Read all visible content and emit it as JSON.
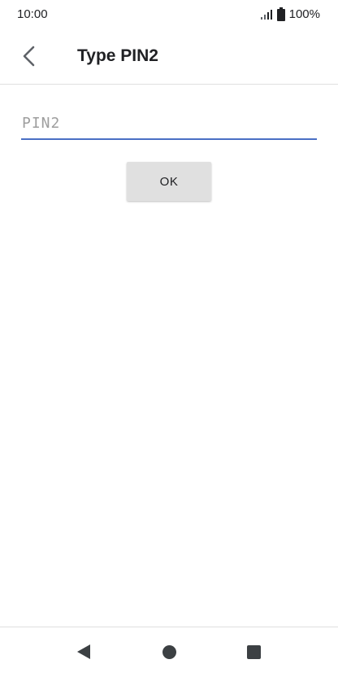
{
  "status_bar": {
    "time": "10:00",
    "battery": "100%",
    "icons": [
      "signal-icon",
      "battery-icon"
    ]
  },
  "app_bar": {
    "back_icon": "chevron-left-icon",
    "title": "Type PIN2"
  },
  "form": {
    "pin_placeholder": "PIN2",
    "pin_value": "",
    "underline_color": "#4a6fc4",
    "ok_label": "OK"
  },
  "nav_bar": {
    "icons": [
      "back-triangle-icon",
      "home-circle-icon",
      "recents-square-icon"
    ]
  }
}
